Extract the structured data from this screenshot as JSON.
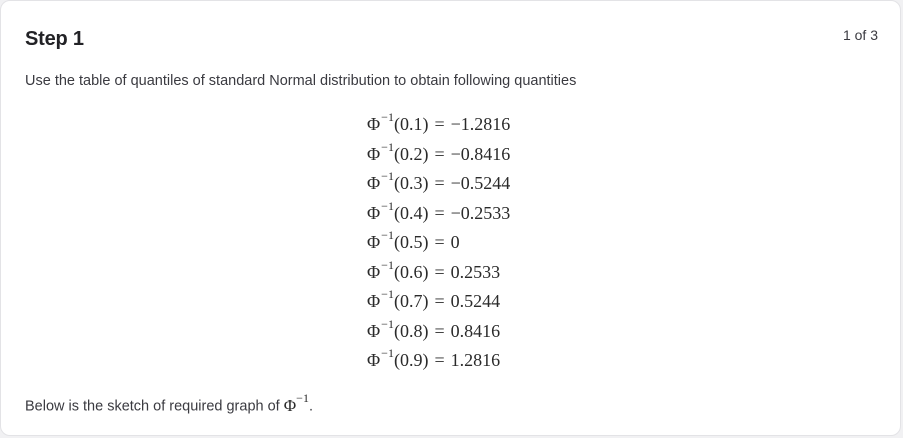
{
  "step": {
    "title": "Step 1",
    "counter": "1 of 3"
  },
  "intro_text": "Use the table of quantiles of standard Normal distribution to obtain following quantities",
  "function_symbol": "Φ",
  "inverse_exponent": "−1",
  "equations": [
    {
      "arg": "(0.1)",
      "eq": "=",
      "value": "−1.2816"
    },
    {
      "arg": "(0.2)",
      "eq": "=",
      "value": "−0.8416"
    },
    {
      "arg": "(0.3)",
      "eq": "=",
      "value": "−0.5244"
    },
    {
      "arg": "(0.4)",
      "eq": "=",
      "value": "−0.2533"
    },
    {
      "arg": "(0.5)",
      "eq": "=",
      "value": "0"
    },
    {
      "arg": "(0.6)",
      "eq": "=",
      "value": "0.2533"
    },
    {
      "arg": "(0.7)",
      "eq": "=",
      "value": "0.5244"
    },
    {
      "arg": "(0.8)",
      "eq": "=",
      "value": "0.8416"
    },
    {
      "arg": "(0.9)",
      "eq": "=",
      "value": "1.2816"
    }
  ],
  "footer": {
    "text": "Below is the sketch of required graph of ",
    "trailing": "."
  }
}
